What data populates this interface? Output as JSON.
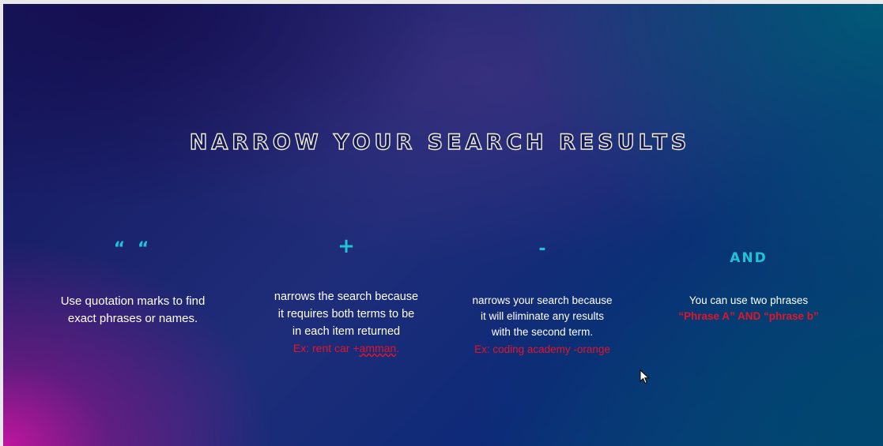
{
  "slide": {
    "title": "NARROW YOUR SEARCH RESULTS",
    "columns": [
      {
        "symbol": "“ “",
        "description_lines": [
          "Use quotation marks to find",
          "exact phrases or names."
        ]
      },
      {
        "symbol": "+",
        "description_lines": [
          "narrows the search because",
          "it requires both terms to be",
          "in each item returned"
        ],
        "example_prefix": "Ex: rent car +",
        "example_underlined": "amman",
        "example_suffix": "."
      },
      {
        "symbol": "-",
        "description_lines": [
          "narrows your search because",
          "it will eliminate any results",
          "with the second term."
        ],
        "example": "Ex: coding academy -orange"
      },
      {
        "symbol": "AND",
        "description_lines": [
          "You can use two phrases"
        ],
        "example": "“Phrase A” AND “phrase b”"
      }
    ]
  },
  "colors": {
    "accent": "#1fc3d6",
    "example_red": "#e2152a",
    "title_outline": "#f3efd9"
  },
  "icons": {
    "cursor": "mouse-pointer-icon"
  }
}
